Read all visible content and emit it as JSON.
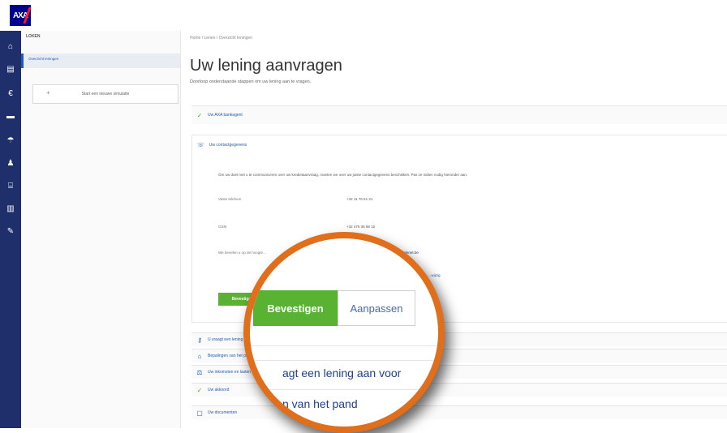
{
  "header": {
    "logo_text": "AXA"
  },
  "rail": {
    "icons": [
      "home-icon",
      "document-icon",
      "euro-icon",
      "car-icon",
      "umbrella-icon",
      "person-icon",
      "bank-icon",
      "chart-icon",
      "tools-icon"
    ]
  },
  "sidebar": {
    "header": "LOKEN",
    "active_item": "Overzicht leningen",
    "new_button": "Start een nieuwe simulatie"
  },
  "main": {
    "breadcrumb": "Home / Lenen / Overzicht leningen",
    "title": "Uw lening aanvragen",
    "subtitle": "Doorloop onderstaande stappen om uw lening aan te vragen.",
    "steps": [
      {
        "label": "Uw AXA bankagent",
        "icon": "check-icon"
      },
      {
        "label": "Uw contactgegevens",
        "icon": "contact-icon"
      },
      {
        "label": "U vraagt een lening aan voor",
        "icon": "key-icon"
      },
      {
        "label": "Bepalingen van het pand",
        "icon": "home-icon"
      },
      {
        "label": "Uw inkomsten en lasten",
        "icon": "scale-icon"
      },
      {
        "label": "Uw akkoord",
        "icon": "check-icon"
      },
      {
        "label": "Uw documenten",
        "icon": "document-icon"
      }
    ],
    "contact": {
      "intro": "Om uw doel met u te communiceren over uw kredietaanvraag, moeten we over uw juiste contactgegevens beschikken. Pas ze indien nodig hieronder aan.",
      "phone_label": "Vaste telefoon",
      "phone_value": "+32 11 75 51 21",
      "gsm_label": "GSM",
      "gsm_value": "+32 476 36 98 10",
      "email_label": "We bevelen u op de hoogte…",
      "email_value": "…@telenet.be",
      "link": "…wijzig"
    },
    "confirm_button": "Bevestigen",
    "edit_button": "Aanpassen"
  },
  "magnifier": {
    "confirm_button": "Bevestigen",
    "edit_button": "Aanpassen",
    "line1": "agt een lening aan voor",
    "line2": "n van het pand"
  }
}
